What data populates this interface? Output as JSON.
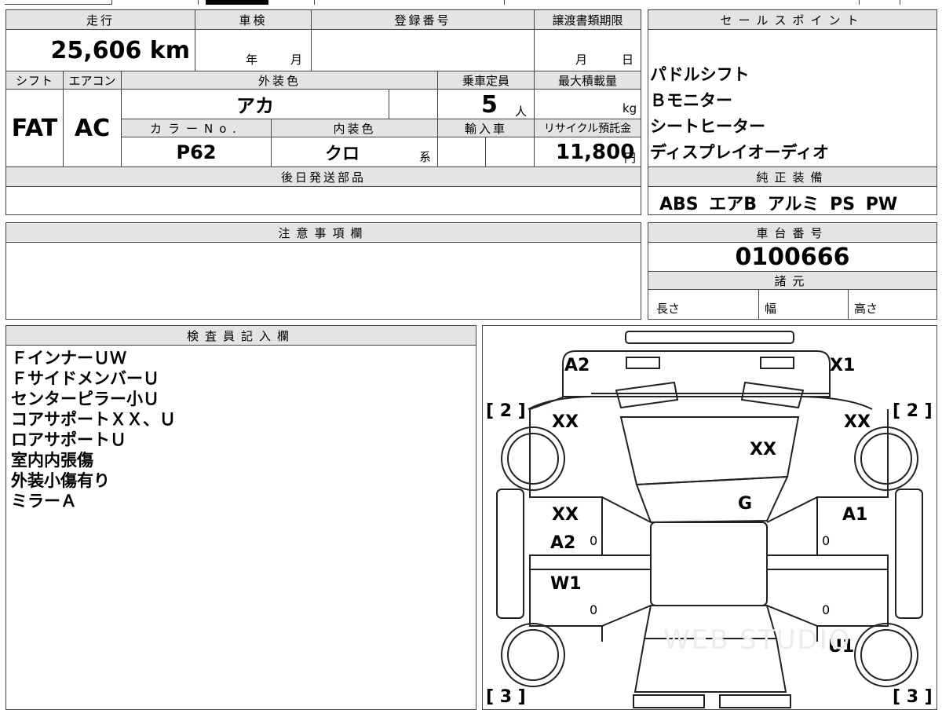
{
  "vehicle": {
    "mileage_label": "走行",
    "mileage_value": "25,606",
    "mileage_unit": "km",
    "shaken_label": "車検",
    "shaken_year": "年",
    "shaken_month": "月",
    "registration_label": "登録番号",
    "transfer_label": "譲渡書類期限",
    "transfer_month": "月",
    "transfer_day": "日",
    "shift_label": "シフト",
    "shift_value": "FAT",
    "aircon_label": "エアコン",
    "aircon_value": "AC",
    "exterior_color_label": "外装色",
    "exterior_color_value": "アカ",
    "capacity_label": "乗車定員",
    "capacity_value": "5",
    "capacity_unit": "人",
    "max_load_label": "最大積載量",
    "max_load_unit": "kg",
    "color_no_label": "カラーNo.",
    "color_no_value": "P62",
    "interior_color_label": "内装色",
    "interior_color_value": "クロ",
    "interior_color_suffix": "系",
    "import_label": "輸入車",
    "recycle_label": "リサイクル預託金",
    "recycle_value": "11,800",
    "recycle_unit": "円",
    "later_parts_label": "後日発送部品"
  },
  "sales_points": {
    "label": "セールスポイント",
    "items": [
      "パドルシフト",
      "Ｂモニター",
      "シートヒーター",
      "ディスプレイオーディオ"
    ]
  },
  "equipment": {
    "label": "純正装備",
    "value": "ABS エアB アルミ PS PW"
  },
  "notes": {
    "label": "注意事項欄"
  },
  "chassis": {
    "label": "車台番号",
    "value": "0100666"
  },
  "specs": {
    "label": "諸元",
    "length": "長さ",
    "width": "幅",
    "height": "高さ"
  },
  "inspector": {
    "label": "検査員記入欄",
    "lines": [
      "ＦインナーＵＷ",
      "ＦサイドメンバーＵ",
      "センターピラー小Ｕ",
      "コアサポートＸＸ、Ｕ",
      "ロアサポートＵ",
      "室内内張傷",
      "外装小傷有り",
      "ミラーＡ"
    ]
  },
  "diagram": {
    "marks": {
      "front_left": "A2",
      "front_right": "X1",
      "fender_left": "XX",
      "fender_right": "XX",
      "hood": "XX",
      "windshield": "G",
      "front_door_left_1": "XX",
      "front_door_left_2": "A2",
      "front_door_right": "A1",
      "rear_door_left": "W1",
      "rear_right": "U1"
    },
    "zero": "0",
    "tire_front_left": "[ 2 ]",
    "tire_front_right": "[ 2 ]",
    "tire_rear_left": "[ 3 ]",
    "tire_rear_right": "[ 3 ]",
    "watermark": "WEB STUDIO"
  }
}
